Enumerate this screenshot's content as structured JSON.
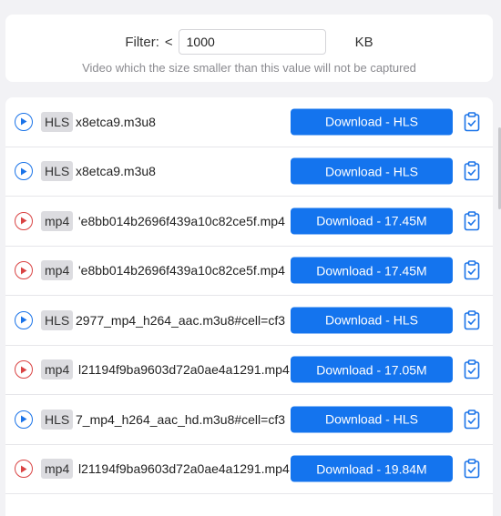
{
  "filter": {
    "label": "Filter:",
    "operator": "<",
    "value": "1000",
    "unit": "KB",
    "hint": "Video which the size smaller than this value will not be captured"
  },
  "colors": {
    "hls_accent": "#1a73e8",
    "mp4_accent": "#d94343",
    "button": "#1474ee",
    "copy_icon": "#1a73e8"
  },
  "icons": {
    "play": "play-circle-icon",
    "copy": "clipboard-check-icon"
  },
  "items": [
    {
      "type": "HLS",
      "filename": "x8etca9.m3u8",
      "button": "Download - HLS"
    },
    {
      "type": "HLS",
      "filename": "x8etca9.m3u8",
      "button": "Download - HLS"
    },
    {
      "type": "mp4",
      "filename": "'e8bb014b2696f439a10c82ce5f.mp4",
      "button": "Download - 17.45M"
    },
    {
      "type": "mp4",
      "filename": "'e8bb014b2696f439a10c82ce5f.mp4",
      "button": "Download - 17.45M"
    },
    {
      "type": "HLS",
      "filename": "2977_mp4_h264_aac.m3u8#cell=cf3",
      "button": "Download - HLS"
    },
    {
      "type": "mp4",
      "filename": "l21194f9ba9603d72a0ae4a1291.mp4",
      "button": "Download - 17.05M"
    },
    {
      "type": "HLS",
      "filename": "7_mp4_h264_aac_hd.m3u8#cell=cf3",
      "button": "Download - HLS"
    },
    {
      "type": "mp4",
      "filename": "l21194f9ba9603d72a0ae4a1291.mp4",
      "button": "Download - 19.84M"
    }
  ]
}
